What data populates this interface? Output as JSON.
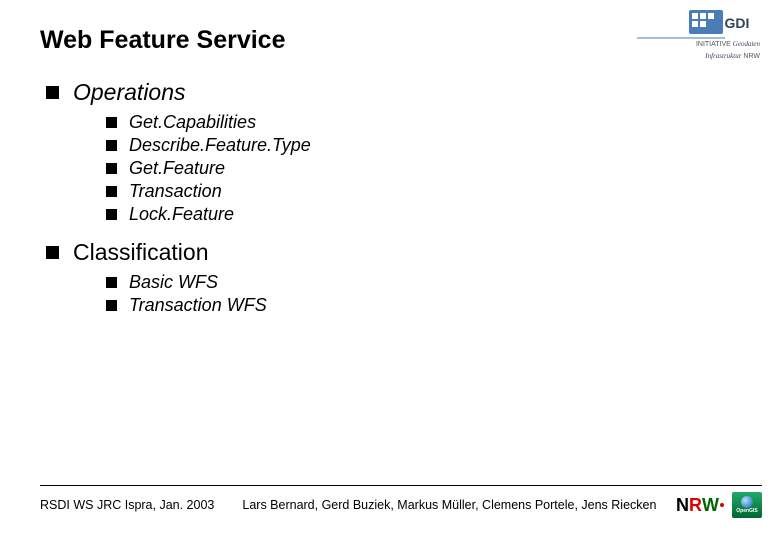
{
  "title": "Web Feature Service",
  "sections": [
    {
      "heading": "Operations",
      "italic_heading": true,
      "items": [
        "Get.Capabilities",
        "Describe.Feature.Type",
        "Get.Feature",
        "Transaction",
        "Lock.Feature"
      ]
    },
    {
      "heading": "Classification",
      "italic_heading": false,
      "items": [
        "Basic WFS",
        "Transaction WFS"
      ]
    }
  ],
  "footer": {
    "date": "RSDI WS JRC Ispra, Jan. 2003",
    "authors": "Lars Bernard, Gerd Buziek, Markus Müller, Clemens Portele, Jens Riecken"
  },
  "logos": {
    "top": {
      "line1": "INITIATIVE Geodaten",
      "line2": "Infrastruktur NRW",
      "abbr": "GDI"
    },
    "nrw": {
      "n": "N",
      "r": "R",
      "w": "W"
    },
    "opengis": "OpenGIS"
  }
}
